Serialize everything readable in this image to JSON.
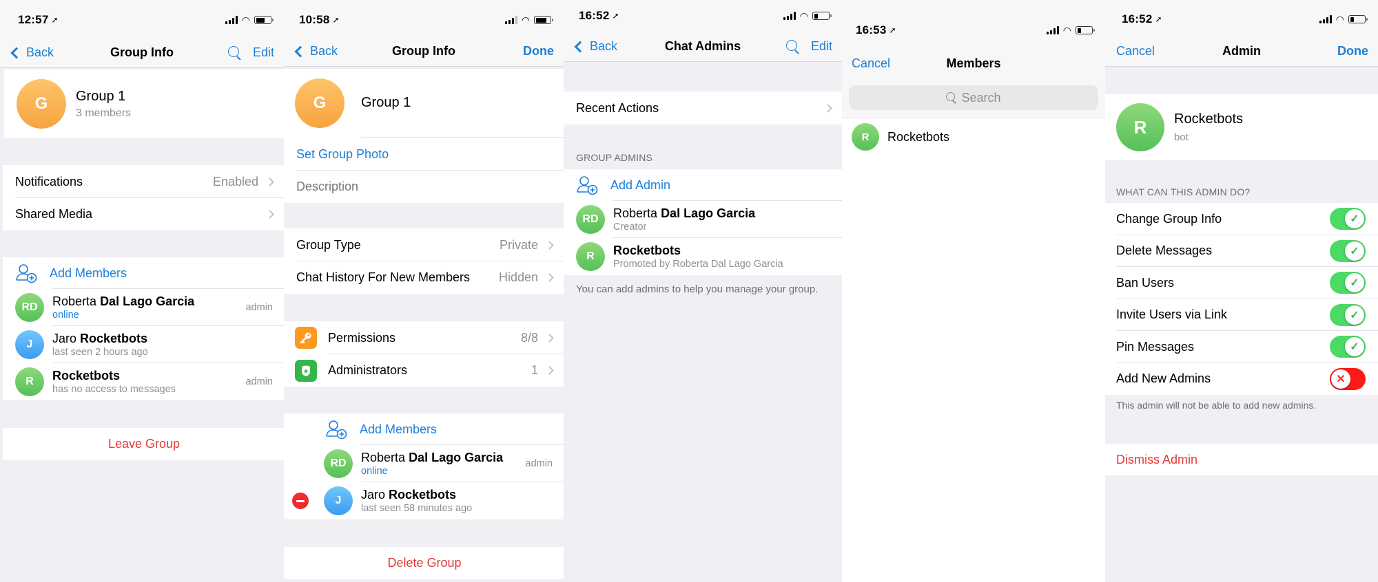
{
  "colors": {
    "accent": "#1a7fd9",
    "destructive": "#e53935",
    "toggle_on": "#4cd964",
    "toggle_off": "#ff1a1a",
    "background": "#efeff4"
  },
  "screens": [
    {
      "status": {
        "time": "12:57"
      },
      "nav": {
        "back": "Back",
        "title": "Group Info",
        "right": "Edit",
        "search_icon": "search-icon"
      },
      "group": {
        "avatar_letter": "G",
        "name": "Group 1",
        "subtitle": "3 members"
      },
      "settings": [
        {
          "label": "Notifications",
          "value": "Enabled"
        },
        {
          "label": "Shared Media",
          "value": ""
        }
      ],
      "add_members": "Add Members",
      "members": [
        {
          "initials": "RD",
          "first": "Roberta",
          "rest": "Dal Lago Garcia",
          "status": "online",
          "badge": "admin"
        },
        {
          "initials": "J",
          "first": "Jaro",
          "rest": "Rocketbots",
          "status": "last seen 2 hours ago",
          "badge": ""
        },
        {
          "initials": "R",
          "first": "",
          "rest": "Rocketbots",
          "status": "has no access to messages",
          "badge": "admin"
        }
      ],
      "leave": "Leave Group"
    },
    {
      "status": {
        "time": "10:58"
      },
      "nav": {
        "back": "Back",
        "title": "Group Info",
        "right": "Done"
      },
      "group": {
        "avatar_letter": "G",
        "name_value": "Group 1"
      },
      "set_photo": "Set Group Photo",
      "description_placeholder": "Description",
      "settings": [
        {
          "label": "Group Type",
          "value": "Private"
        },
        {
          "label": "Chat History For New Members",
          "value": "Hidden"
        }
      ],
      "admin_rows": [
        {
          "icon": "key-icon",
          "label": "Permissions",
          "value": "8/8"
        },
        {
          "icon": "shield-star-icon",
          "label": "Administrators",
          "value": "1"
        }
      ],
      "add_members": "Add Members",
      "members": [
        {
          "initials": "RD",
          "first": "Roberta",
          "rest": "Dal Lago Garcia",
          "status": "online",
          "badge": "admin"
        },
        {
          "initials": "J",
          "first": "Jaro",
          "rest": "Rocketbots",
          "status": "last seen 58 minutes ago",
          "badge": ""
        }
      ],
      "delete": "Delete Group"
    },
    {
      "status": {
        "time": "16:52"
      },
      "nav": {
        "back": "Back",
        "title": "Chat Admins",
        "right": "Edit"
      },
      "recent_actions": "Recent Actions",
      "section_header": "GROUP ADMINS",
      "add_admin": "Add Admin",
      "admins": [
        {
          "initials": "RD",
          "first": "Roberta",
          "rest": "Dal Lago Garcia",
          "status": "Creator"
        },
        {
          "initials": "R",
          "first": "",
          "rest": "Rocketbots",
          "status": "Promoted by Roberta Dal Lago Garcia"
        }
      ],
      "footnote": "You can add admins to help you manage your group."
    },
    {
      "status": {
        "time": "16:53"
      },
      "nav": {
        "left": "Cancel",
        "title": "Members"
      },
      "search_placeholder": "Search",
      "members": [
        {
          "initials": "R",
          "name": "Rocketbots"
        }
      ]
    },
    {
      "status": {
        "time": "16:52"
      },
      "nav": {
        "left": "Cancel",
        "title": "Admin",
        "right": "Done"
      },
      "user": {
        "initials": "R",
        "name": "Rocketbots",
        "subtitle": "bot"
      },
      "section_header": "WHAT CAN THIS ADMIN DO?",
      "permissions": [
        {
          "label": "Change Group Info",
          "enabled": true
        },
        {
          "label": "Delete Messages",
          "enabled": true
        },
        {
          "label": "Ban Users",
          "enabled": true
        },
        {
          "label": "Invite Users via Link",
          "enabled": true
        },
        {
          "label": "Pin Messages",
          "enabled": true
        },
        {
          "label": "Add New Admins",
          "enabled": false
        }
      ],
      "footnote": "This admin will not be able to add new admins.",
      "dismiss": "Dismiss Admin"
    }
  ]
}
